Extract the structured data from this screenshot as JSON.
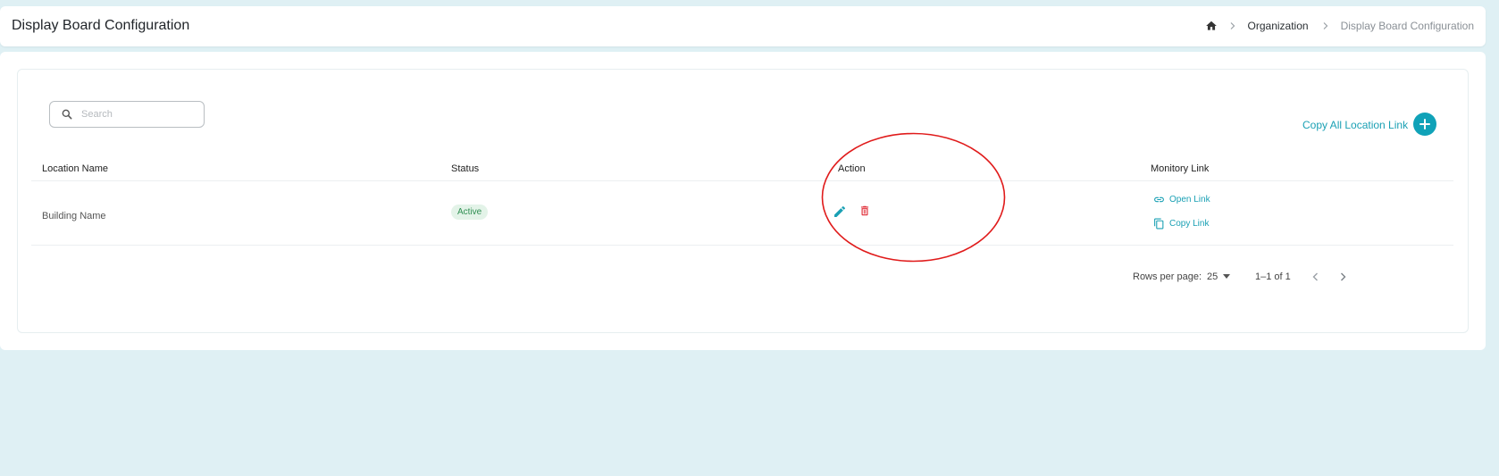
{
  "header": {
    "title": "Display Board Configuration",
    "breadcrumb": [
      "Organization",
      "Display Board Configuration"
    ]
  },
  "toolbar": {
    "search_placeholder": "Search",
    "search_value": "",
    "copy_all_label": "Copy All Location Link"
  },
  "table": {
    "columns": [
      "Location Name",
      "Status",
      "Action",
      "Monitory Link"
    ],
    "rows": [
      {
        "location_name": "Building Name",
        "status": "Active",
        "links": {
          "open": "Open Link",
          "copy": "Copy Link"
        }
      }
    ]
  },
  "pagination": {
    "rows_per_page_label": "Rows per page:",
    "rows_per_page": "25",
    "range": "1–1 of 1"
  },
  "icons": {
    "home": "home-icon",
    "search": "search-icon",
    "add": "plus-icon",
    "edit": "pencil-icon",
    "delete": "trash-icon",
    "open": "link-icon",
    "copy": "copy-icon"
  },
  "colors": {
    "accent": "#10a2b8",
    "link": "#1aa0b4",
    "danger": "#e0303b",
    "status_bg": "#e3f3e8",
    "status_fg": "#2f8f52",
    "background": "#dff0f4",
    "annotation": "#e01b1b"
  }
}
